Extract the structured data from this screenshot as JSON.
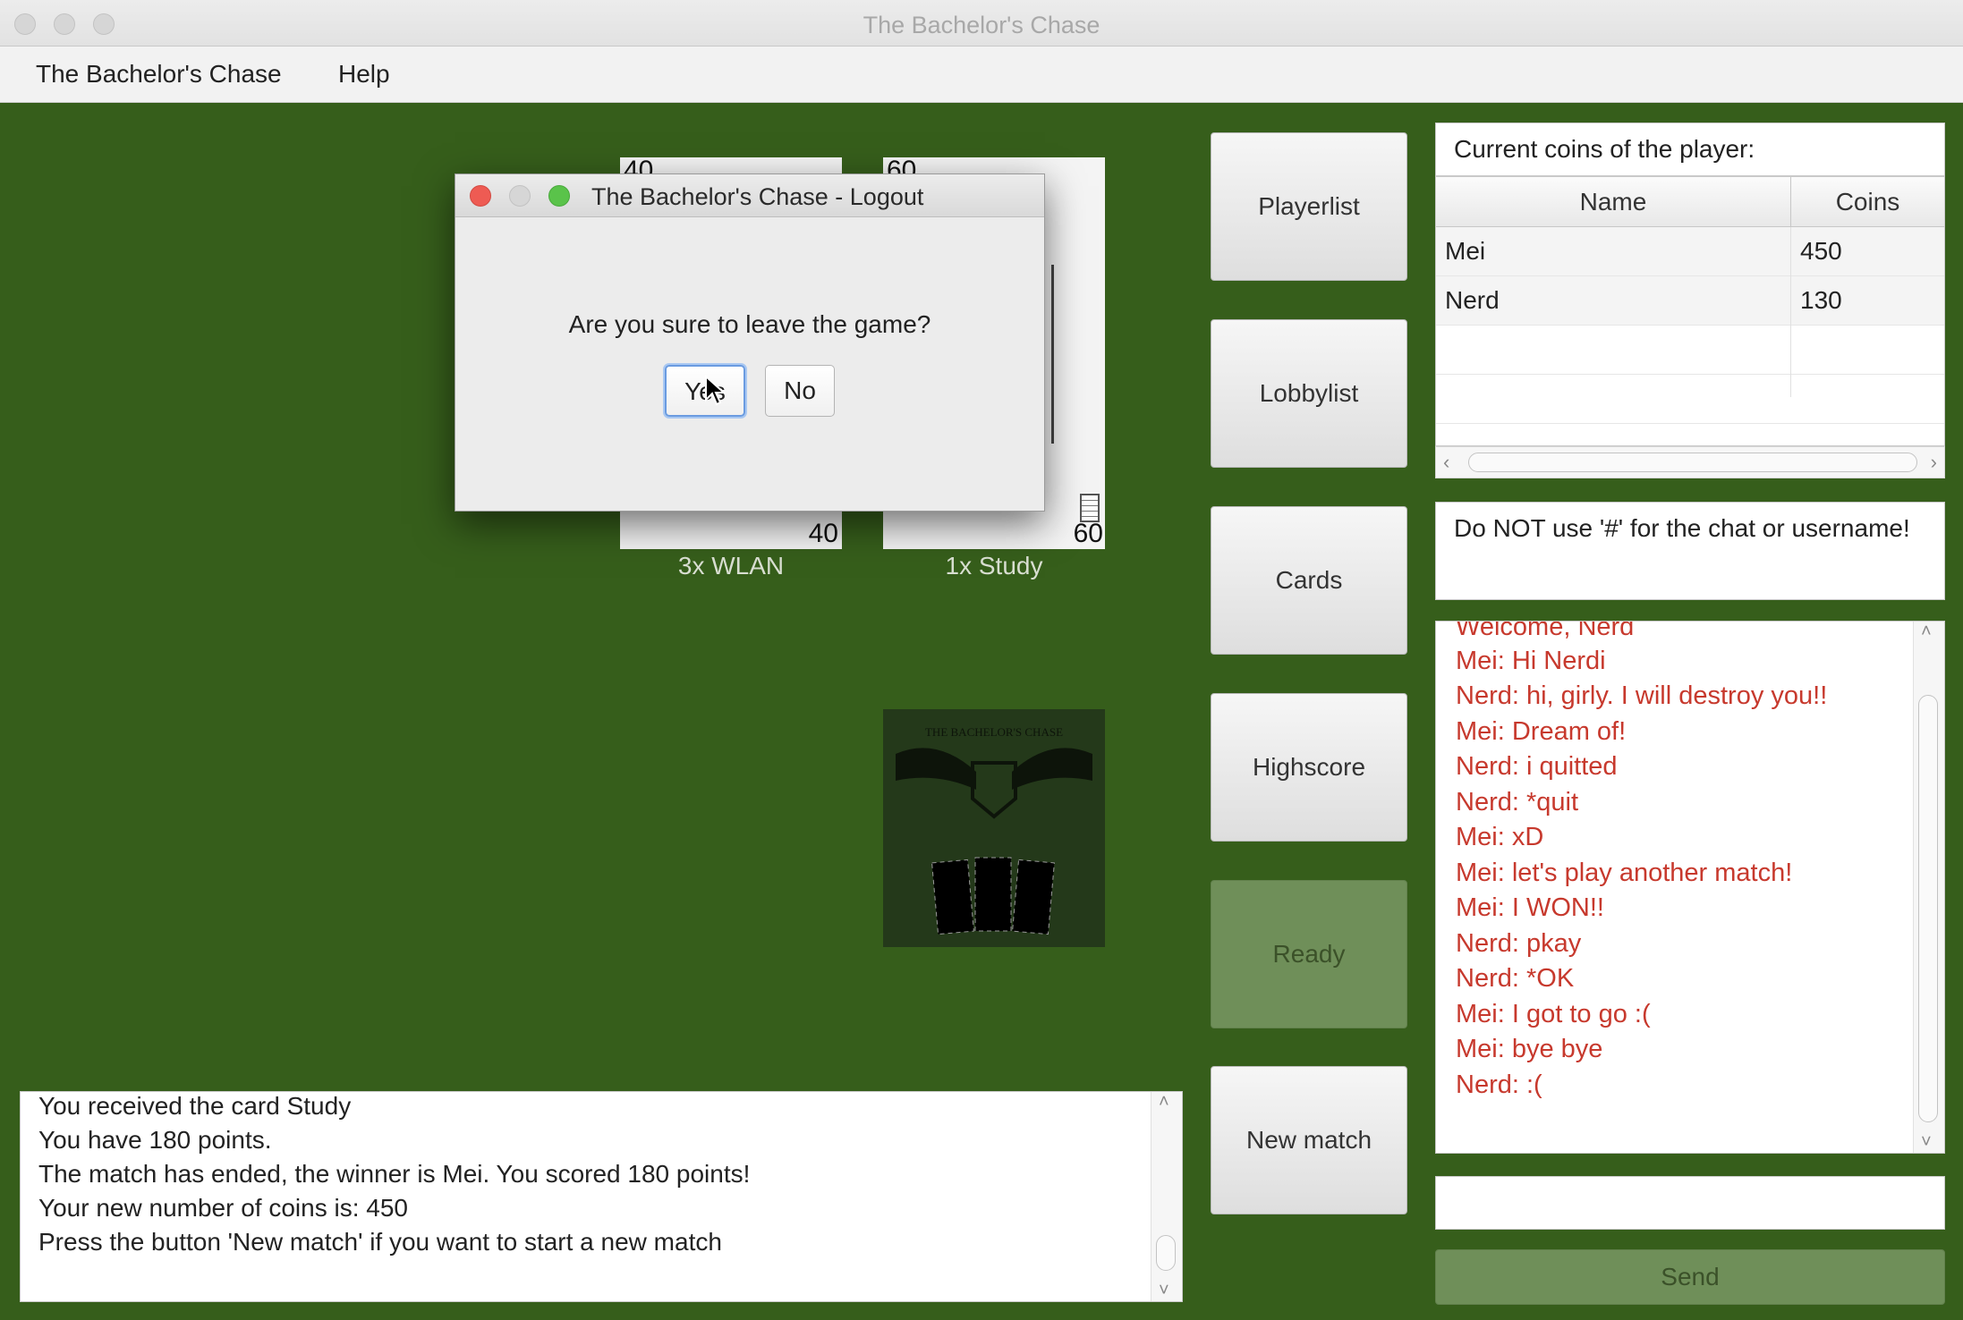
{
  "window": {
    "title": "The Bachelor's Chase"
  },
  "menu": {
    "items": [
      "The Bachelor's Chase",
      "Help"
    ]
  },
  "cards": {
    "wlan": {
      "top_value": "40",
      "bottom_value": "40",
      "label": "3x WLAN"
    },
    "study": {
      "top_value": "60",
      "bottom_value": "60",
      "label": "1x Study"
    },
    "deck_logo_text": "THE BACHELOR'S CHASE"
  },
  "dialog": {
    "title": "The Bachelor's Chase - Logout",
    "question": "Are you sure to leave the game?",
    "yes_label": "Yes",
    "no_label": "No"
  },
  "side_buttons": {
    "playerlist": "Playerlist",
    "lobbylist": "Lobbylist",
    "cards": "Cards",
    "highscore": "Highscore",
    "ready": "Ready",
    "new_match": "New match"
  },
  "coins": {
    "header": "Current coins of the player:",
    "columns": [
      "Name",
      "Coins"
    ],
    "rows": [
      {
        "name": "Mei",
        "coins": "450"
      },
      {
        "name": "Nerd",
        "coins": "130"
      }
    ]
  },
  "info": {
    "text": "Do NOT use '#' for the chat or username!"
  },
  "chat": {
    "lines": [
      "Welcome, Nerd",
      "Mei: Hi Nerdi",
      "Nerd: hi, girly. I will destroy you!!",
      "Mei: Dream of!",
      "Nerd: i quitted",
      "Nerd: *quit",
      "Mei: xD",
      "Mei: let's play another match!",
      "Mei: I WON!!",
      "Nerd: pkay",
      "Nerd: *OK",
      "Mei: I got to go :(",
      "Mei: bye bye",
      "Nerd: :("
    ],
    "input_value": "",
    "send_label": "Send"
  },
  "log": {
    "lines": [
      "You received the card Study",
      "You have 180 points.",
      "The match has ended, the winner is Mei. You scored 180 points!",
      "Your new number of coins is: 450",
      "Press the button 'New match' if you want to start a new match"
    ]
  },
  "colors": {
    "table_green": "#365e1b",
    "chat_text": "#c7392d",
    "disabled_button": "#6f8f59"
  }
}
